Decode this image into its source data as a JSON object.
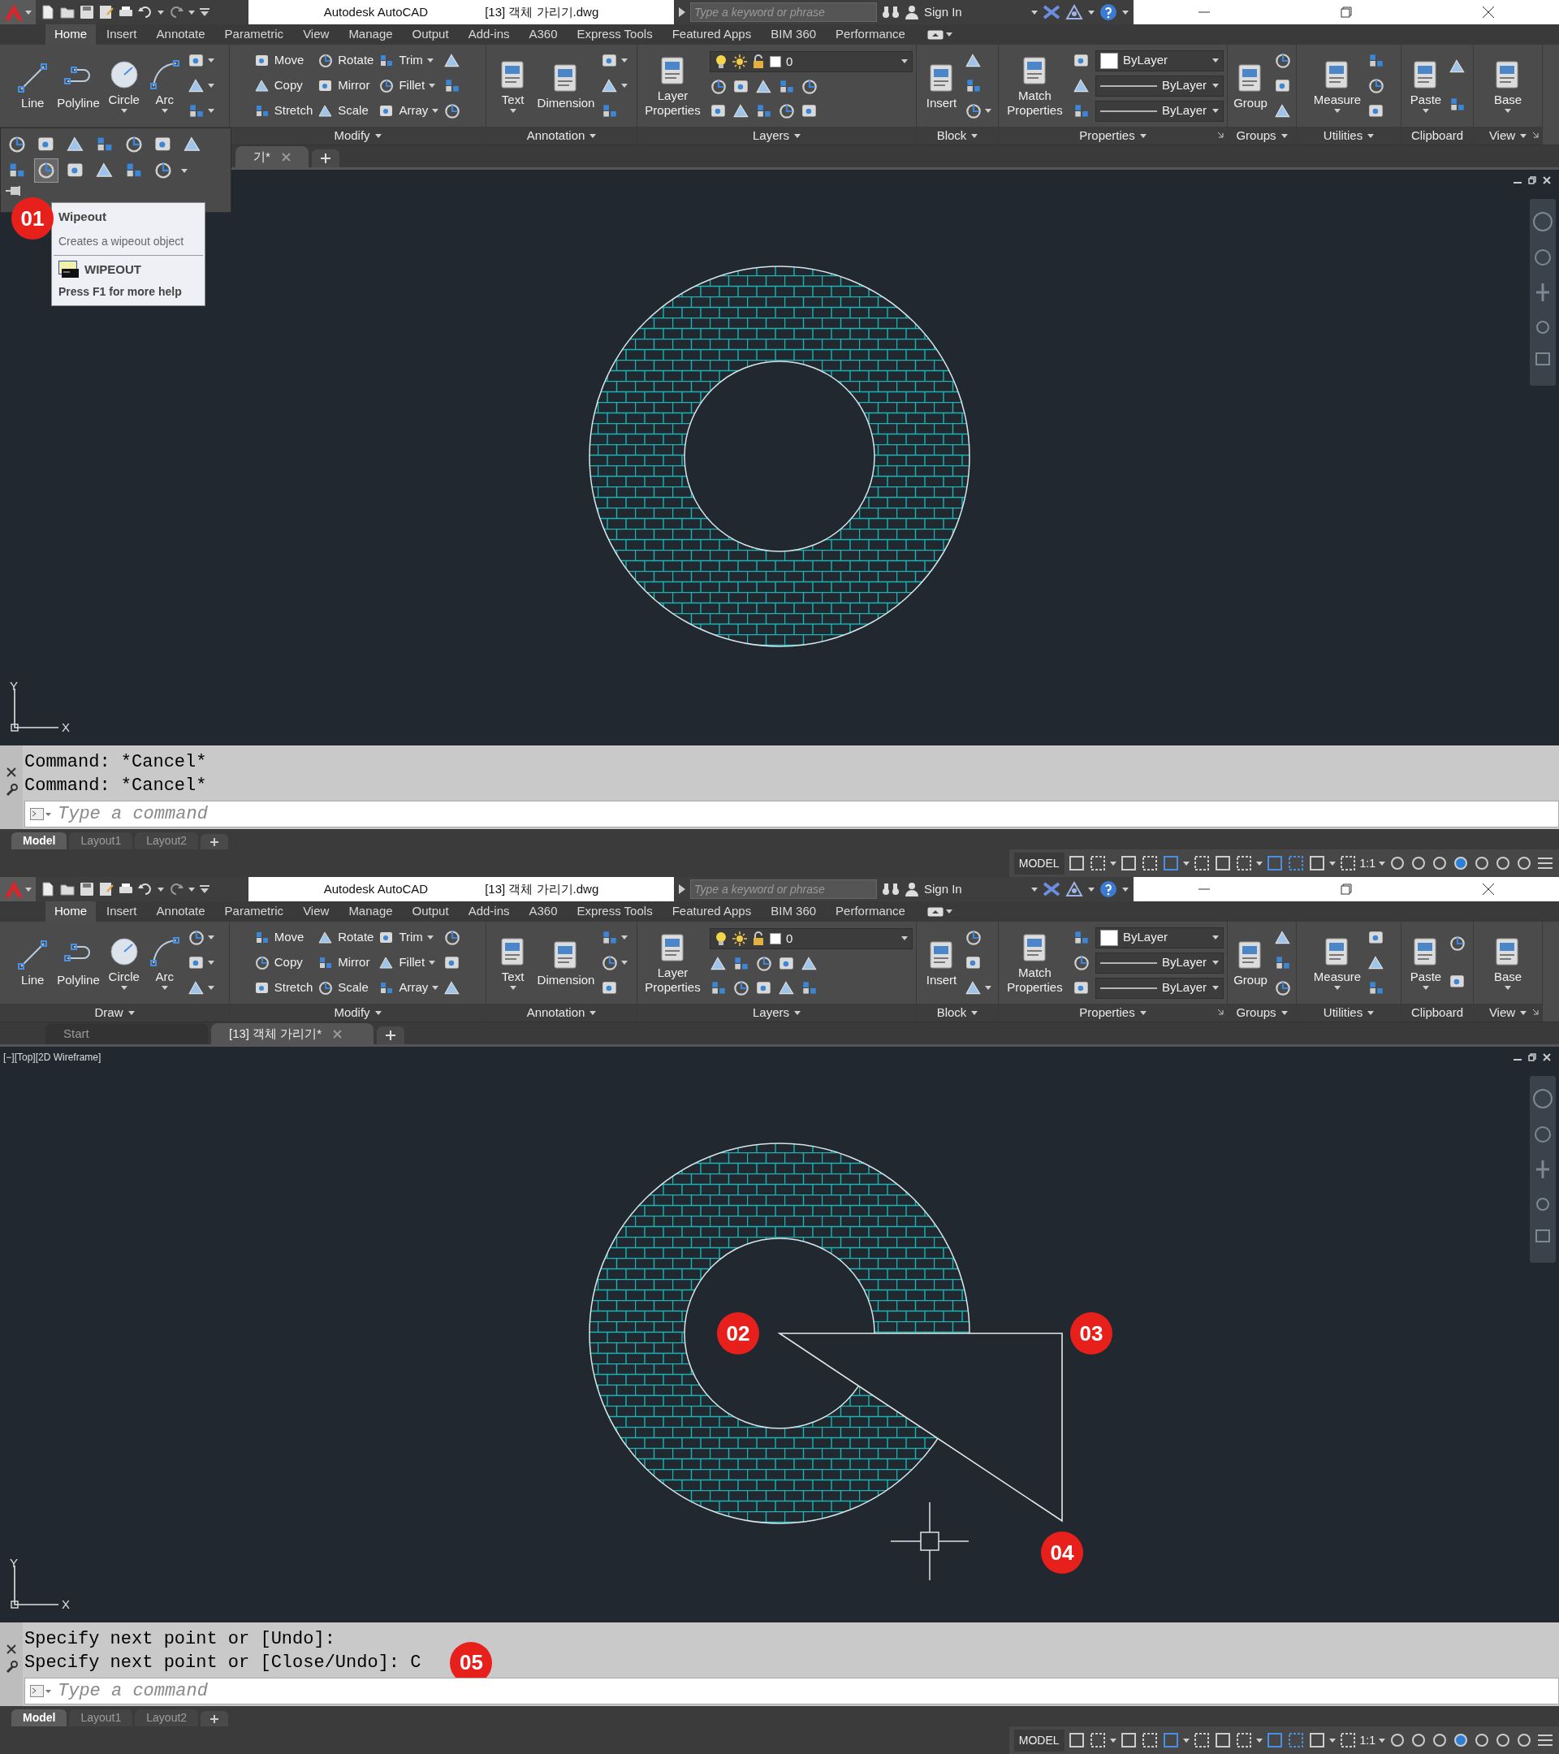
{
  "windows": [
    {
      "title_bar": {
        "app_title": "Autodesk AutoCAD",
        "file_name": "[13] 객체 가리기.dwg",
        "search": {
          "placeholder": "Type a keyword or phrase"
        },
        "sign_in": "Sign In"
      },
      "ribbon_tabs": [
        {
          "label": "Home",
          "selected": true
        },
        {
          "label": "Insert",
          "selected": false
        },
        {
          "label": "Annotate",
          "selected": false
        },
        {
          "label": "Parametric",
          "selected": false
        },
        {
          "label": "View",
          "selected": false
        },
        {
          "label": "Manage",
          "selected": false
        },
        {
          "label": "Output",
          "selected": false
        },
        {
          "label": "Add-ins",
          "selected": false
        },
        {
          "label": "A360",
          "selected": false
        },
        {
          "label": "Express Tools",
          "selected": false
        },
        {
          "label": "Featured Apps",
          "selected": false
        },
        {
          "label": "BIM 360",
          "selected": false
        },
        {
          "label": "Performance",
          "selected": false
        }
      ],
      "ribbon_panels": [
        {
          "expanded": true,
          "flyout": {
            "rows": [
              [
                {
                  "selected": false
                },
                {
                  "selected": false
                },
                {
                  "selected": false
                },
                {
                  "selected": false
                },
                {
                  "selected": false
                },
                {
                  "selected": false
                },
                {
                  "selected": false
                }
              ],
              [
                {
                  "selected": false
                },
                {
                  "selected": true
                },
                {
                  "selected": false
                },
                {
                  "selected": false
                },
                {
                  "selected": false
                },
                {
                  "selected": false
                }
              ]
            ]
          },
          "columns": [
            [
              [
                {
                  "kind": "large",
                  "label": "Line"
                }
              ]
            ],
            [
              [
                {
                  "kind": "large",
                  "label": "Polyline"
                }
              ]
            ],
            [
              [
                {
                  "kind": "large",
                  "label": "Circle",
                  "caret": true
                }
              ]
            ],
            [
              [
                {
                  "kind": "large",
                  "label": "Arc",
                  "caret": true
                }
              ]
            ],
            [
              [
                {
                  "kind": "icon",
                  "caret": true
                }
              ],
              [
                {
                  "kind": "icon",
                  "caret": true
                }
              ],
              [
                {
                  "kind": "icon",
                  "caret": true
                }
              ]
            ]
          ]
        },
        {
          "label": "Modify",
          "caret": true,
          "columns": [
            [
              [
                {
                  "kind": "small",
                  "label": "Move"
                }
              ],
              [
                {
                  "kind": "small",
                  "label": "Copy"
                }
              ],
              [
                {
                  "kind": "small",
                  "label": "Stretch"
                }
              ]
            ],
            [
              [
                {
                  "kind": "small",
                  "label": "Rotate"
                }
              ],
              [
                {
                  "kind": "small",
                  "label": "Mirror"
                }
              ],
              [
                {
                  "kind": "small",
                  "label": "Scale"
                }
              ]
            ],
            [
              [
                {
                  "kind": "small",
                  "label": "Trim",
                  "caret": true
                }
              ],
              [
                {
                  "kind": "small",
                  "label": "Fillet",
                  "caret": true
                }
              ],
              [
                {
                  "kind": "small",
                  "label": "Array",
                  "caret": true
                }
              ]
            ],
            [
              [
                {
                  "kind": "icon"
                }
              ],
              [
                {
                  "kind": "icon"
                }
              ],
              [
                {
                  "kind": "icon"
                }
              ]
            ]
          ]
        },
        {
          "label": "Annotation",
          "caret": true,
          "columns": [
            [
              [
                {
                  "kind": "large",
                  "label": "Text",
                  "caret": true
                }
              ]
            ],
            [
              [
                {
                  "kind": "large",
                  "label": "Dimension"
                }
              ]
            ],
            [
              [
                {
                  "kind": "icon",
                  "caret": true
                }
              ],
              [
                {
                  "kind": "icon",
                  "caret": true
                }
              ],
              [
                {
                  "kind": "icon"
                }
              ]
            ]
          ]
        },
        {
          "label": "Layers",
          "caret": true,
          "columns": [
            [
              [
                {
                  "kind": "large",
                  "label": "Layer Properties"
                }
              ]
            ],
            [
              [
                {
                  "kind": "layer_dropdown",
                  "label": "0"
                }
              ],
              [
                {
                  "kind": "icon"
                },
                {
                  "kind": "icon"
                },
                {
                  "kind": "icon"
                },
                {
                  "kind": "icon"
                },
                {
                  "kind": "icon"
                }
              ],
              [
                {
                  "kind": "icon"
                },
                {
                  "kind": "icon"
                },
                {
                  "kind": "icon"
                },
                {
                  "kind": "icon"
                },
                {
                  "kind": "icon"
                }
              ]
            ]
          ]
        },
        {
          "label": "Block",
          "caret": true,
          "columns": [
            [
              [
                {
                  "kind": "large",
                  "label": "Insert"
                }
              ]
            ],
            [
              [
                {
                  "kind": "icon"
                }
              ],
              [
                {
                  "kind": "icon"
                }
              ],
              [
                {
                  "kind": "icon",
                  "caret": true
                }
              ]
            ]
          ]
        },
        {
          "label": "Properties",
          "caret": true,
          "launcher": true,
          "columns": [
            [
              [
                {
                  "kind": "large",
                  "label": "Match Properties"
                }
              ]
            ],
            [
              [
                {
                  "kind": "icon"
                }
              ],
              [
                {
                  "kind": "icon"
                }
              ],
              [
                {
                  "kind": "icon"
                }
              ]
            ],
            [
              [
                {
                  "kind": "swatch_dropdown",
                  "label": "ByLayer"
                }
              ],
              [
                {
                  "kind": "line_dropdown",
                  "label": "ByLayer"
                }
              ],
              [
                {
                  "kind": "line_dropdown",
                  "label": "ByLayer"
                }
              ]
            ]
          ]
        },
        {
          "label": "Groups",
          "caret": true,
          "columns": [
            [
              [
                {
                  "kind": "large",
                  "label": "Group"
                }
              ]
            ],
            [
              [
                {
                  "kind": "icon"
                }
              ],
              [
                {
                  "kind": "icon"
                }
              ],
              [
                {
                  "kind": "icon"
                }
              ]
            ]
          ]
        },
        {
          "label": "Utilities",
          "caret": true,
          "columns": [
            [
              [
                {
                  "kind": "large",
                  "label": "Measure",
                  "caret": true
                }
              ]
            ],
            [
              [
                {
                  "kind": "icon"
                }
              ],
              [
                {
                  "kind": "icon"
                }
              ],
              [
                {
                  "kind": "icon"
                }
              ]
            ]
          ]
        },
        {
          "label": "Clipboard",
          "columns": [
            [
              [
                {
                  "kind": "large",
                  "label": "Paste",
                  "caret": true
                }
              ]
            ],
            [
              [
                {
                  "kind": "icon"
                }
              ],
              [
                {
                  "kind": "icon"
                }
              ]
            ]
          ]
        },
        {
          "label": "View",
          "caret": true,
          "launcher": true,
          "columns": [
            [
              [
                {
                  "kind": "large",
                  "label": "Base",
                  "caret": true
                }
              ]
            ]
          ]
        }
      ],
      "tooltip": {
        "title": "Wipeout",
        "description": "Creates a wipeout object",
        "command": "WIPEOUT",
        "help": "Press F1 for more help",
        "callout": "01"
      },
      "file_tabs": [
        {
          "label": "기*",
          "selected": true,
          "closable": true
        }
      ],
      "viewport": {
        "polyline_shown": false,
        "cursor_shown": false,
        "ucs": {
          "y": "Y",
          "x": "X"
        }
      },
      "command_line": {
        "history": [
          {
            "text": "Command: *Cancel*"
          },
          {
            "text": "Command: *Cancel*"
          }
        ],
        "input": {
          "placeholder": "Type a command"
        }
      },
      "layout_tabs": [
        {
          "label": "Model",
          "selected": true
        },
        {
          "label": "Layout1",
          "selected": false
        },
        {
          "label": "Layout2",
          "selected": false
        }
      ],
      "status_bar": {
        "mode": "MODEL",
        "scale": "1:1"
      }
    },
    {
      "title_bar": {
        "app_title": "Autodesk AutoCAD",
        "file_name": "[13] 객체 가리기.dwg",
        "search": {
          "placeholder": "Type a keyword or phrase"
        },
        "sign_in": "Sign In"
      },
      "ribbon_tabs": [
        {
          "label": "Home",
          "selected": true
        },
        {
          "label": "Insert",
          "selected": false
        },
        {
          "label": "Annotate",
          "selected": false
        },
        {
          "label": "Parametric",
          "selected": false
        },
        {
          "label": "View",
          "selected": false
        },
        {
          "label": "Manage",
          "selected": false
        },
        {
          "label": "Output",
          "selected": false
        },
        {
          "label": "Add-ins",
          "selected": false
        },
        {
          "label": "A360",
          "selected": false
        },
        {
          "label": "Express Tools",
          "selected": false
        },
        {
          "label": "Featured Apps",
          "selected": false
        },
        {
          "label": "BIM 360",
          "selected": false
        },
        {
          "label": "Performance",
          "selected": false
        }
      ],
      "ribbon_panels": [
        {
          "label": "Draw",
          "caret": true,
          "expanded": false,
          "columns": [
            [
              [
                {
                  "kind": "large",
                  "label": "Line"
                }
              ]
            ],
            [
              [
                {
                  "kind": "large",
                  "label": "Polyline"
                }
              ]
            ],
            [
              [
                {
                  "kind": "large",
                  "label": "Circle",
                  "caret": true
                }
              ]
            ],
            [
              [
                {
                  "kind": "large",
                  "label": "Arc",
                  "caret": true
                }
              ]
            ],
            [
              [
                {
                  "kind": "icon",
                  "caret": true
                }
              ],
              [
                {
                  "kind": "icon",
                  "caret": true
                }
              ],
              [
                {
                  "kind": "icon",
                  "caret": true
                }
              ]
            ]
          ]
        },
        {
          "label": "Modify",
          "caret": true,
          "columns": [
            [
              [
                {
                  "kind": "small",
                  "label": "Move"
                }
              ],
              [
                {
                  "kind": "small",
                  "label": "Copy"
                }
              ],
              [
                {
                  "kind": "small",
                  "label": "Stretch"
                }
              ]
            ],
            [
              [
                {
                  "kind": "small",
                  "label": "Rotate"
                }
              ],
              [
                {
                  "kind": "small",
                  "label": "Mirror"
                }
              ],
              [
                {
                  "kind": "small",
                  "label": "Scale"
                }
              ]
            ],
            [
              [
                {
                  "kind": "small",
                  "label": "Trim",
                  "caret": true
                }
              ],
              [
                {
                  "kind": "small",
                  "label": "Fillet",
                  "caret": true
                }
              ],
              [
                {
                  "kind": "small",
                  "label": "Array",
                  "caret": true
                }
              ]
            ],
            [
              [
                {
                  "kind": "icon"
                }
              ],
              [
                {
                  "kind": "icon"
                }
              ],
              [
                {
                  "kind": "icon"
                }
              ]
            ]
          ]
        },
        {
          "label": "Annotation",
          "caret": true,
          "columns": [
            [
              [
                {
                  "kind": "large",
                  "label": "Text",
                  "caret": true
                }
              ]
            ],
            [
              [
                {
                  "kind": "large",
                  "label": "Dimension"
                }
              ]
            ],
            [
              [
                {
                  "kind": "icon",
                  "caret": true
                }
              ],
              [
                {
                  "kind": "icon",
                  "caret": true
                }
              ],
              [
                {
                  "kind": "icon"
                }
              ]
            ]
          ]
        },
        {
          "label": "Layers",
          "caret": true,
          "columns": [
            [
              [
                {
                  "kind": "large",
                  "label": "Layer Properties"
                }
              ]
            ],
            [
              [
                {
                  "kind": "layer_dropdown",
                  "label": "0"
                }
              ],
              [
                {
                  "kind": "icon"
                },
                {
                  "kind": "icon"
                },
                {
                  "kind": "icon"
                },
                {
                  "kind": "icon"
                },
                {
                  "kind": "icon"
                }
              ],
              [
                {
                  "kind": "icon"
                },
                {
                  "kind": "icon"
                },
                {
                  "kind": "icon"
                },
                {
                  "kind": "icon"
                },
                {
                  "kind": "icon"
                }
              ]
            ]
          ]
        },
        {
          "label": "Block",
          "caret": true,
          "columns": [
            [
              [
                {
                  "kind": "large",
                  "label": "Insert"
                }
              ]
            ],
            [
              [
                {
                  "kind": "icon"
                }
              ],
              [
                {
                  "kind": "icon"
                }
              ],
              [
                {
                  "kind": "icon",
                  "caret": true
                }
              ]
            ]
          ]
        },
        {
          "label": "Properties",
          "caret": true,
          "launcher": true,
          "columns": [
            [
              [
                {
                  "kind": "large",
                  "label": "Match Properties"
                }
              ]
            ],
            [
              [
                {
                  "kind": "icon"
                }
              ],
              [
                {
                  "kind": "icon"
                }
              ],
              [
                {
                  "kind": "icon"
                }
              ]
            ],
            [
              [
                {
                  "kind": "swatch_dropdown",
                  "label": "ByLayer"
                }
              ],
              [
                {
                  "kind": "line_dropdown",
                  "label": "ByLayer"
                }
              ],
              [
                {
                  "kind": "line_dropdown",
                  "label": "ByLayer"
                }
              ]
            ]
          ]
        },
        {
          "label": "Groups",
          "caret": true,
          "columns": [
            [
              [
                {
                  "kind": "large",
                  "label": "Group"
                }
              ]
            ],
            [
              [
                {
                  "kind": "icon"
                }
              ],
              [
                {
                  "kind": "icon"
                }
              ],
              [
                {
                  "kind": "icon"
                }
              ]
            ]
          ]
        },
        {
          "label": "Utilities",
          "caret": true,
          "columns": [
            [
              [
                {
                  "kind": "large",
                  "label": "Measure",
                  "caret": true
                }
              ]
            ],
            [
              [
                {
                  "kind": "icon"
                }
              ],
              [
                {
                  "kind": "icon"
                }
              ],
              [
                {
                  "kind": "icon"
                }
              ]
            ]
          ]
        },
        {
          "label": "Clipboard",
          "columns": [
            [
              [
                {
                  "kind": "large",
                  "label": "Paste",
                  "caret": true
                }
              ]
            ],
            [
              [
                {
                  "kind": "icon"
                }
              ],
              [
                {
                  "kind": "icon"
                }
              ]
            ]
          ]
        },
        {
          "label": "View",
          "caret": true,
          "launcher": true,
          "columns": [
            [
              [
                {
                  "kind": "large",
                  "label": "Base",
                  "caret": true
                }
              ]
            ]
          ]
        }
      ],
      "file_tabs": [
        {
          "label": "Start",
          "selected": false,
          "closable": false
        },
        {
          "label": "[13] 객체 가리기*",
          "selected": true,
          "closable": true
        }
      ],
      "viewport": {
        "label": "[−][Top][2D Wireframe]",
        "polyline_shown": true,
        "cursor_shown": true,
        "callouts": [
          "02",
          "03",
          "04"
        ],
        "ucs": {
          "y": "Y",
          "x": "X"
        }
      },
      "command_line": {
        "history": [
          {
            "text": "Specify next point or [Undo]:"
          },
          {
            "text": "Specify next point or [Close/Undo]: C",
            "callout": "05"
          }
        ],
        "input": {
          "placeholder": "Type a command"
        }
      },
      "layout_tabs": [
        {
          "label": "Model",
          "selected": true
        },
        {
          "label": "Layout1",
          "selected": false
        },
        {
          "label": "Layout2",
          "selected": false
        }
      ],
      "status_bar": {
        "mode": "MODEL",
        "scale": "1:1"
      }
    }
  ]
}
